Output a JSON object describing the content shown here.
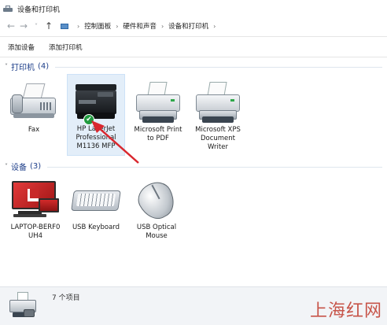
{
  "window": {
    "title": "设备和打印机",
    "icon": "devices-printers-icon"
  },
  "address_bar": {
    "back_icon": "arrow-left-icon",
    "forward_icon": "arrow-right-icon",
    "up_icon": "arrow-up-icon",
    "breadcrumb": [
      "控制面板",
      "硬件和声音",
      "设备和打印机"
    ],
    "separator": "›"
  },
  "command_bar": {
    "add_device": "添加设备",
    "add_printer": "添加打印机"
  },
  "printers_group": {
    "title": "打印机",
    "count": "(4)",
    "items": [
      {
        "label_lines": [
          "Fax"
        ],
        "icon": "fax-icon"
      },
      {
        "label_lines": [
          "HP LaserJet",
          "Professional",
          "M1136 MFP"
        ],
        "icon": "hp-laserjet-mfp-icon",
        "selected": true,
        "default_badge": "✔"
      },
      {
        "label_lines": [
          "Microsoft Print",
          "to PDF"
        ],
        "icon": "printer-icon"
      },
      {
        "label_lines": [
          "Microsoft XPS",
          "Document",
          "Writer"
        ],
        "icon": "printer-icon"
      }
    ]
  },
  "devices_group": {
    "title": "设备",
    "count": "(3)",
    "items": [
      {
        "label_lines": [
          "LAPTOP-BERF0",
          "UH4"
        ],
        "icon": "computer-icon"
      },
      {
        "label_lines": [
          "USB Keyboard"
        ],
        "icon": "keyboard-icon"
      },
      {
        "label_lines": [
          "USB Optical",
          "Mouse"
        ],
        "icon": "mouse-icon"
      }
    ]
  },
  "details_pane": {
    "summary": "7 个项目",
    "icon": "printer-camera-icon"
  },
  "watermark": "上海红网",
  "colors": {
    "group_header": "#1e3f8a",
    "selection": "#e3eef9",
    "annotation_arrow": "#d9272e",
    "default_badge": "#1f9a3f"
  }
}
